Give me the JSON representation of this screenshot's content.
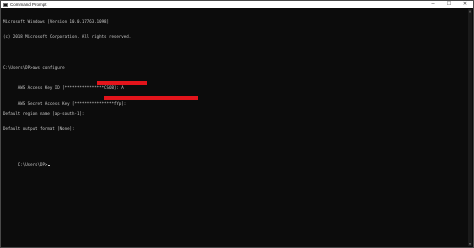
{
  "window": {
    "title": "Command Prompt",
    "controls": {
      "minimize": "─",
      "maximize": "☐",
      "close": "✕"
    }
  },
  "console": {
    "lines": [
      "Microsoft Windows [Version 10.0.17763.1098]",
      "(c) 2018 Microsoft Corporation. All rights reserved.",
      "",
      "C:\\Users\\DP>aws configure",
      "AWS Access Key ID [****************CSOB]: A",
      "AWS Secret Access Key [****************fYp]:",
      "Default region name [ap-south-1]:",
      "Default output format [None]:",
      "",
      "C:\\Users\\DP>"
    ]
  },
  "colors": {
    "background": "#0c0c0c",
    "text": "#cccccc",
    "redaction": "#e3141b",
    "titlebar": "#ffffff"
  },
  "scrollbar": {
    "up_glyph": "▲",
    "down_glyph": "▼"
  }
}
